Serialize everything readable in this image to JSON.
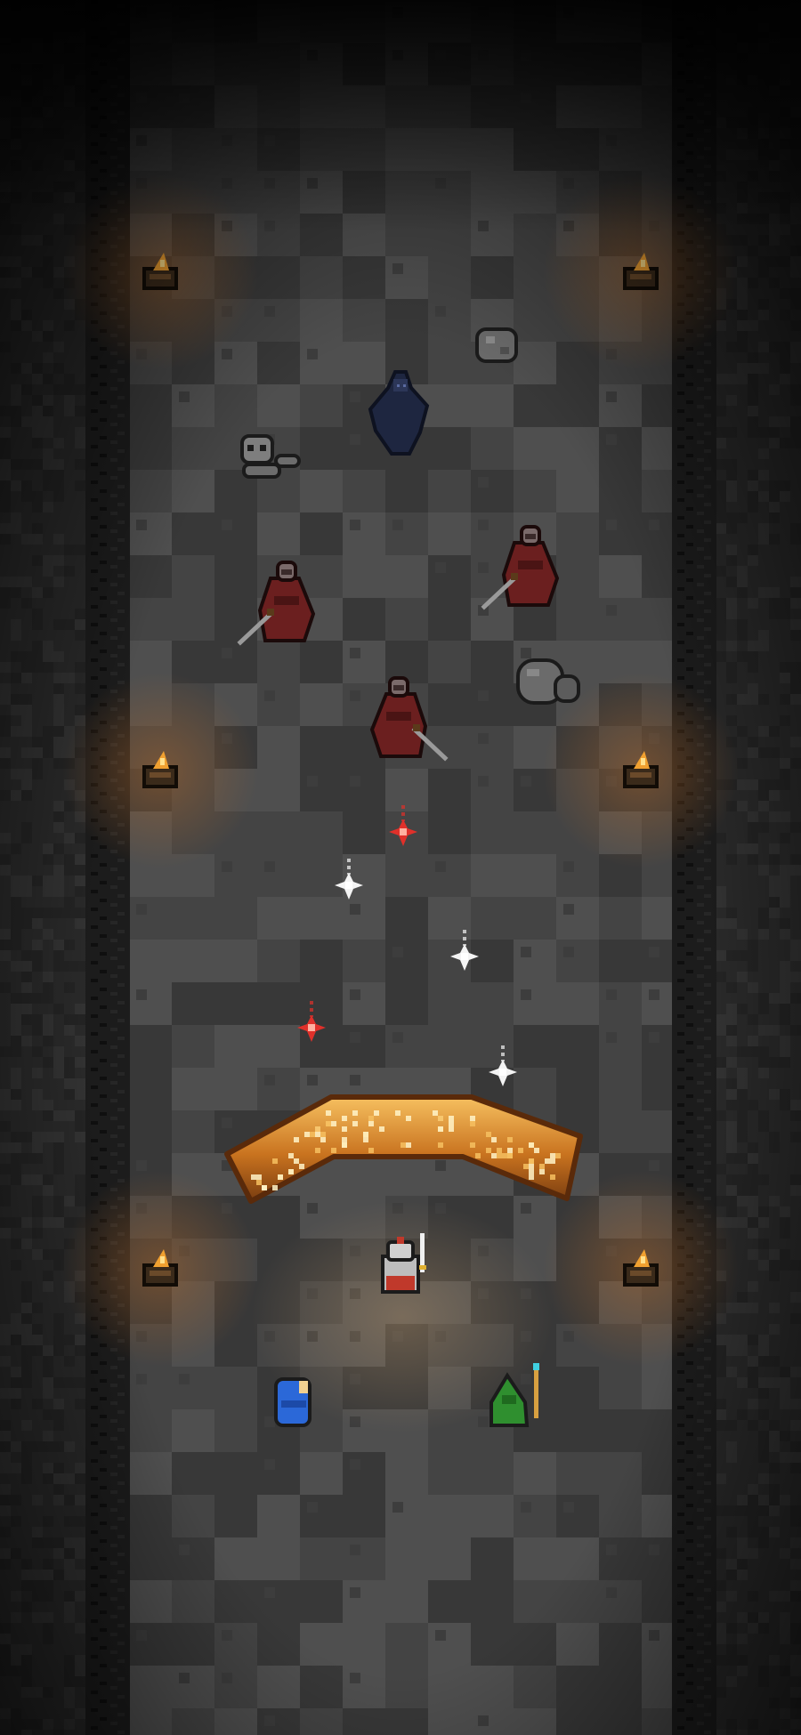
{
  "scene": {
    "type": "dungeon-corridor",
    "palette": {
      "void": "#0a0a0a",
      "outer_stone": "#2a2a2a",
      "wall_edge": "#1c1c1c",
      "floor_dark": "#383838",
      "floor_mid": "#444444",
      "floor_light": "#4f4f4f",
      "torch_glow": "#b56a2a",
      "torch_flame": "#f0a030",
      "barrier_fill": "#c9731f",
      "barrier_highlight": "#f6c060",
      "barrier_shadow": "#7a3d10",
      "bandit_cloak": "#6b1f1f",
      "spark_red": "#e0302a",
      "spark_white": "#f4f4f4",
      "knight_armor": "#bdbdbd",
      "knight_tabard": "#c0392b",
      "mage_robe": "#2b68d8",
      "archer_hood": "#2f8f2f"
    }
  },
  "entities": {
    "torches": [
      "torch",
      "torch",
      "torch",
      "torch",
      "torch",
      "torch"
    ],
    "enemies": [
      {
        "kind": "shadow-wraith",
        "color": "#1e2640"
      },
      {
        "kind": "bandit-swordsman",
        "color": "#6b1f1f"
      },
      {
        "kind": "bandit-swordsman",
        "color": "#6b1f1f"
      },
      {
        "kind": "bandit-swordsman",
        "color": "#6b1f1f"
      }
    ],
    "debris": [
      "rock-pile",
      "skull-bones",
      "boulder"
    ],
    "projectiles": [
      {
        "kind": "red-spark"
      },
      {
        "kind": "white-spark"
      },
      {
        "kind": "white-spark"
      },
      {
        "kind": "red-spark"
      },
      {
        "kind": "white-spark"
      }
    ],
    "barrier": {
      "kind": "fire-barrier-arc"
    },
    "party": [
      {
        "kind": "knight",
        "role": "leader"
      },
      {
        "kind": "mage"
      },
      {
        "kind": "archer"
      }
    ]
  }
}
